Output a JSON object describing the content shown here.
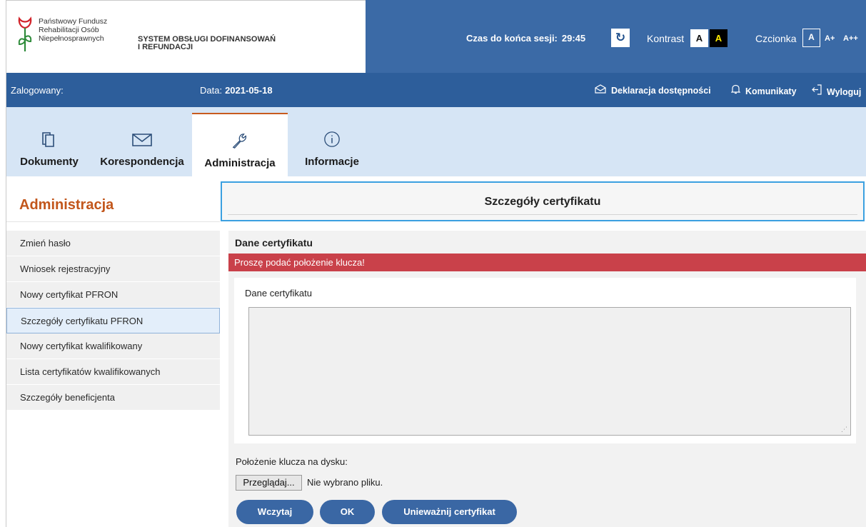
{
  "header": {
    "logo_lines": [
      "Państwowy Fundusz",
      "Rehabilitacji Osób",
      "Niepełnosprawnych"
    ],
    "system_lines": [
      "SYSTEM OBSŁUGI DOFINANSOWAŃ",
      "I REFUNDACJI"
    ],
    "session_label": "Czas do końca sesji:",
    "session_time": "29:45",
    "refresh_icon": "↻",
    "kontrast_label": "Kontrast",
    "kontrast_normal": "A",
    "kontrast_high": "A",
    "czcionka_label": "Czcionka",
    "font_normal": "A",
    "font_larger": "A+",
    "font_largest": "A++"
  },
  "topbar": {
    "logged_label": "Zalogowany:",
    "date_label": "Data:",
    "date_value": "2021-05-18",
    "declaration": "Deklaracja dostępności",
    "messages": "Komunikaty",
    "logout": "Wyloguj"
  },
  "tabs": [
    {
      "label": "Dokumenty",
      "icon": "documents-icon"
    },
    {
      "label": "Korespondencja",
      "icon": "envelope-icon"
    },
    {
      "label": "Administracja",
      "icon": "wrench-icon",
      "active": true
    },
    {
      "label": "Informacje",
      "icon": "info-icon"
    }
  ],
  "sidebar": {
    "title": "Administracja",
    "items": [
      {
        "label": "Zmień hasło"
      },
      {
        "label": "Wniosek rejestracyjny"
      },
      {
        "label": "Nowy certyfikat PFRON"
      },
      {
        "label": "Szczegóły certyfikatu PFRON",
        "active": true
      },
      {
        "label": "Nowy certyfikat kwalifikowany"
      },
      {
        "label": "Lista certyfikatów kwalifikowanych"
      },
      {
        "label": "Szczegóły beneficjenta"
      }
    ]
  },
  "main": {
    "page_title": "Szczegóły certyfikatu",
    "section_title": "Dane certyfikatu",
    "alert": "Proszę podać położenie klucza!",
    "textarea_label": "Dane certyfikatu",
    "textarea_value": "",
    "key_label": "Położenie klucza na dysku:",
    "browse_button": "Przeglądaj...",
    "no_file": "Nie wybrano pliku.",
    "buttons": {
      "load": "Wczytaj",
      "ok": "OK",
      "revoke": "Unieważnij certyfikat"
    }
  },
  "colors": {
    "header_blue": "#3b6aa6",
    "bar_blue": "#2d5e9b",
    "tabs_bg": "#d6e5f5",
    "accent_orange": "#c2561b",
    "alert_red": "#c9414a",
    "button_blue": "#3a67a4",
    "focus_border": "#3ba0e0"
  }
}
